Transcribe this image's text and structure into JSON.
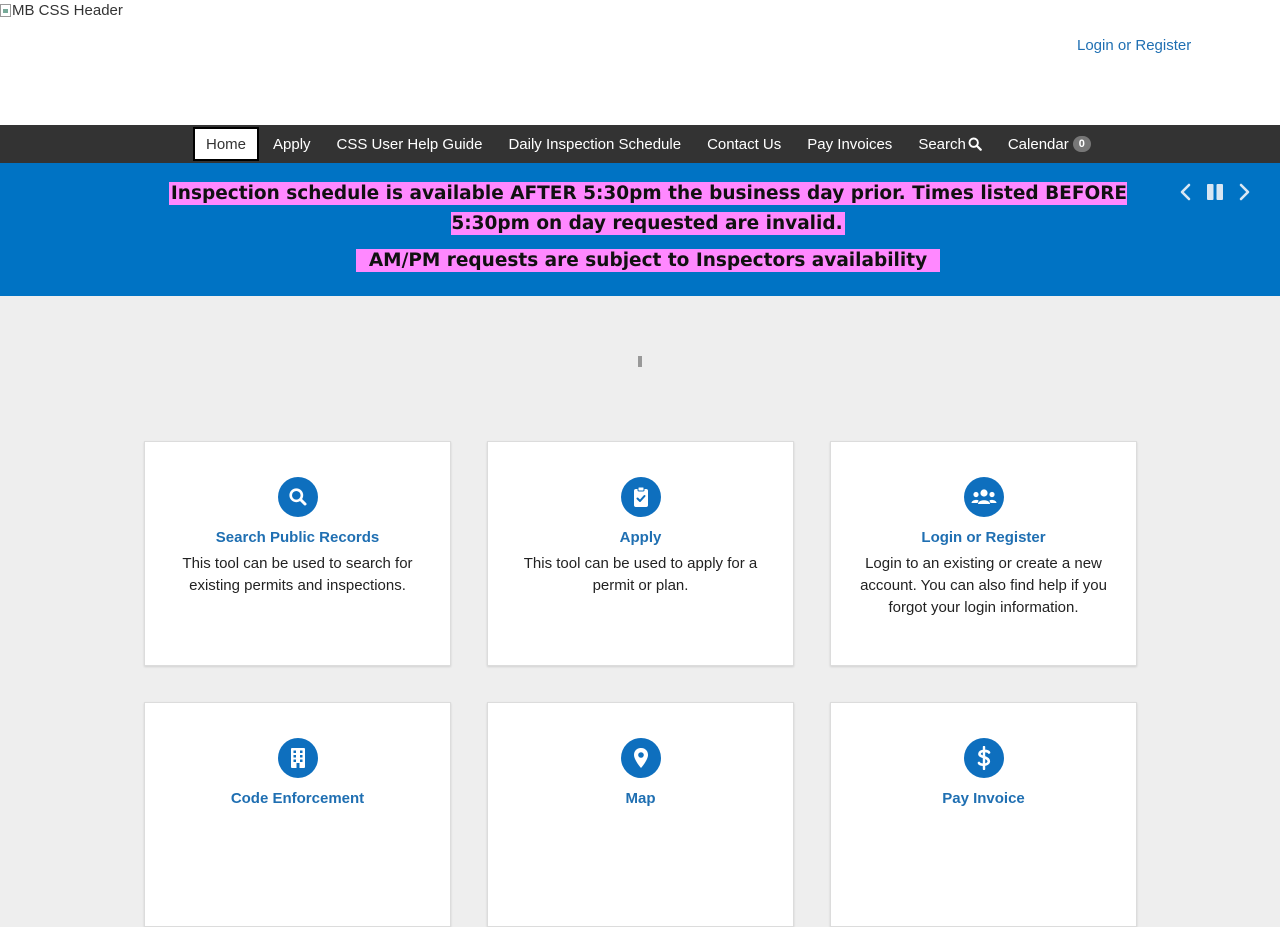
{
  "header": {
    "logo_alt": "MB CSS Header",
    "login_link": "Login or Register"
  },
  "nav": {
    "items": [
      {
        "label": "Home",
        "active": true
      },
      {
        "label": "Apply"
      },
      {
        "label": "CSS User Help Guide"
      },
      {
        "label": "Daily Inspection Schedule"
      },
      {
        "label": "Contact Us"
      },
      {
        "label": "Pay Invoices"
      },
      {
        "label": "Search",
        "icon": "search-icon"
      },
      {
        "label": "Calendar",
        "badge": "0"
      }
    ]
  },
  "banner": {
    "line1": "Inspection schedule is available AFTER 5:30pm the business day prior. Times listed BEFORE 5:30pm on day requested are invalid.",
    "line2": "AM/PM requests are subject to Inspectors availability",
    "controls": [
      "chevron-left-icon",
      "pause-icon",
      "chevron-right-icon"
    ],
    "background": "#0073c4",
    "highlight": "#ff88ff"
  },
  "cards": [
    {
      "title": "Search Public Records",
      "desc": "This tool can be used to search for existing permits and inspections.",
      "icon": "search-icon"
    },
    {
      "title": "Apply",
      "desc": "This tool can be used to apply for a permit or plan.",
      "icon": "clipboard-check-icon"
    },
    {
      "title": "Login or Register",
      "desc": "Login to an existing or create a new account. You can also find help if you forgot your login information.",
      "icon": "users-icon"
    },
    {
      "title": "Code Enforcement",
      "desc": "",
      "icon": "building-icon"
    },
    {
      "title": "Map",
      "desc": "",
      "icon": "map-marker-icon"
    },
    {
      "title": "Pay Invoice",
      "desc": "",
      "icon": "dollar-icon"
    }
  ],
  "colors": {
    "accent": "#0e6fbe",
    "link": "#1f6fb2",
    "nav_bg": "#333333",
    "page_bg": "#eeeeee"
  }
}
